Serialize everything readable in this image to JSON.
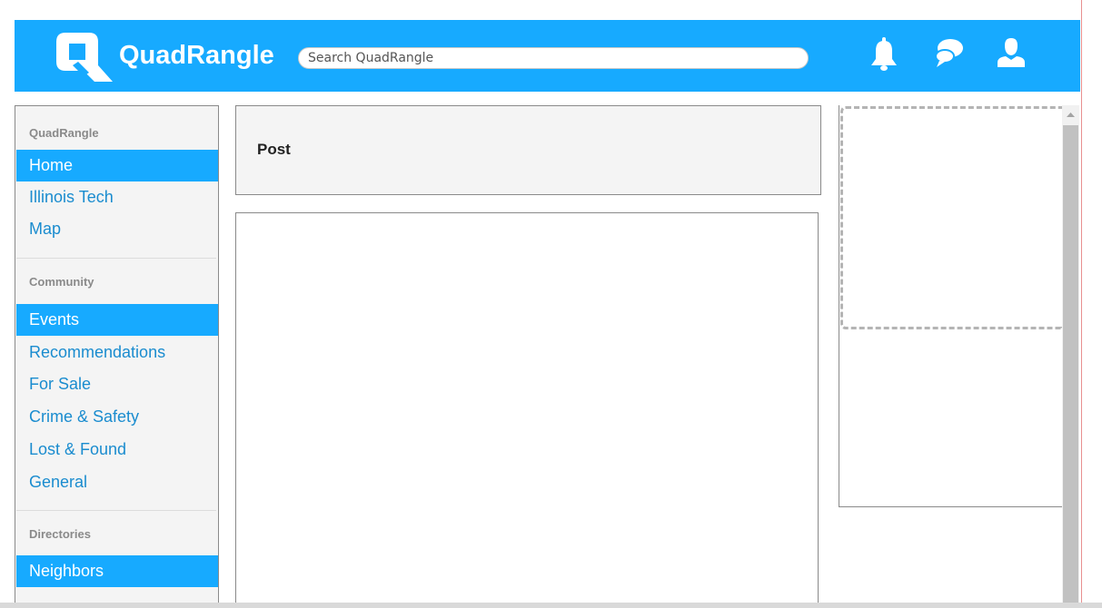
{
  "header": {
    "brand": "QuadRangle",
    "search_placeholder": "Search QuadRangle",
    "icons": [
      "bell-icon",
      "chat-icon",
      "user-icon"
    ],
    "accent_color": "#17aaff"
  },
  "sidebar": {
    "sections": [
      {
        "title": "QuadRangle",
        "items": [
          {
            "label": "Home",
            "active": true
          },
          {
            "label": "Illinois Tech",
            "active": false
          },
          {
            "label": "Map",
            "active": false
          }
        ]
      },
      {
        "title": "Community",
        "items": [
          {
            "label": "Events",
            "active": true
          },
          {
            "label": "Recommendations",
            "active": false
          },
          {
            "label": "For Sale",
            "active": false
          },
          {
            "label": "Crime & Safety",
            "active": false
          },
          {
            "label": "Lost & Found",
            "active": false
          },
          {
            "label": "General",
            "active": false
          }
        ]
      },
      {
        "title": "Directories",
        "items": [
          {
            "label": "Neighbors",
            "active": true
          }
        ]
      }
    ]
  },
  "main": {
    "post_label": "Post"
  }
}
